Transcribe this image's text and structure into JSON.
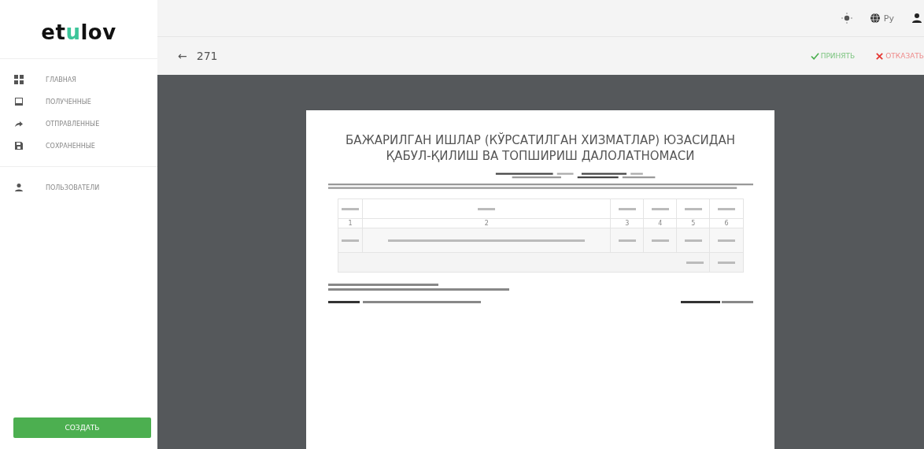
{
  "logo": {
    "before": "et",
    "accent": "u",
    "after": "lov"
  },
  "nav": [
    {
      "label": "ГЛАВНАЯ",
      "selected": false
    },
    {
      "label": "ПОЛУЧЕННЫЕ",
      "selected": false
    },
    {
      "label": "ОТПРАВЛЕННЫЕ",
      "selected": false
    },
    {
      "label": "СОХРАНЕННЫЕ",
      "selected": false
    }
  ],
  "nav_secondary": [
    {
      "label": "ПОЛЬЗОВАТЕЛИ",
      "selected": false
    }
  ],
  "create_button": "СОЗДАТЬ",
  "topbar": {
    "language": "Ру"
  },
  "toolbar": {
    "back": "←",
    "number": "271",
    "accept": "ПРИНЯТЬ",
    "reject": "ОТКАЗАТЬ"
  },
  "document": {
    "title": "БАЖАРИЛГАН ИШЛАР (КЎРСАТИЛГАН ХИЗМАТЛАР) ЮЗАСИДАН ҚАБУЛ-ҚИЛИШ ВА ТОПШИРИШ ДАЛОЛАТНОМАСИ",
    "column_indices": [
      "1",
      "2",
      "3",
      "4",
      "5",
      "6"
    ]
  }
}
